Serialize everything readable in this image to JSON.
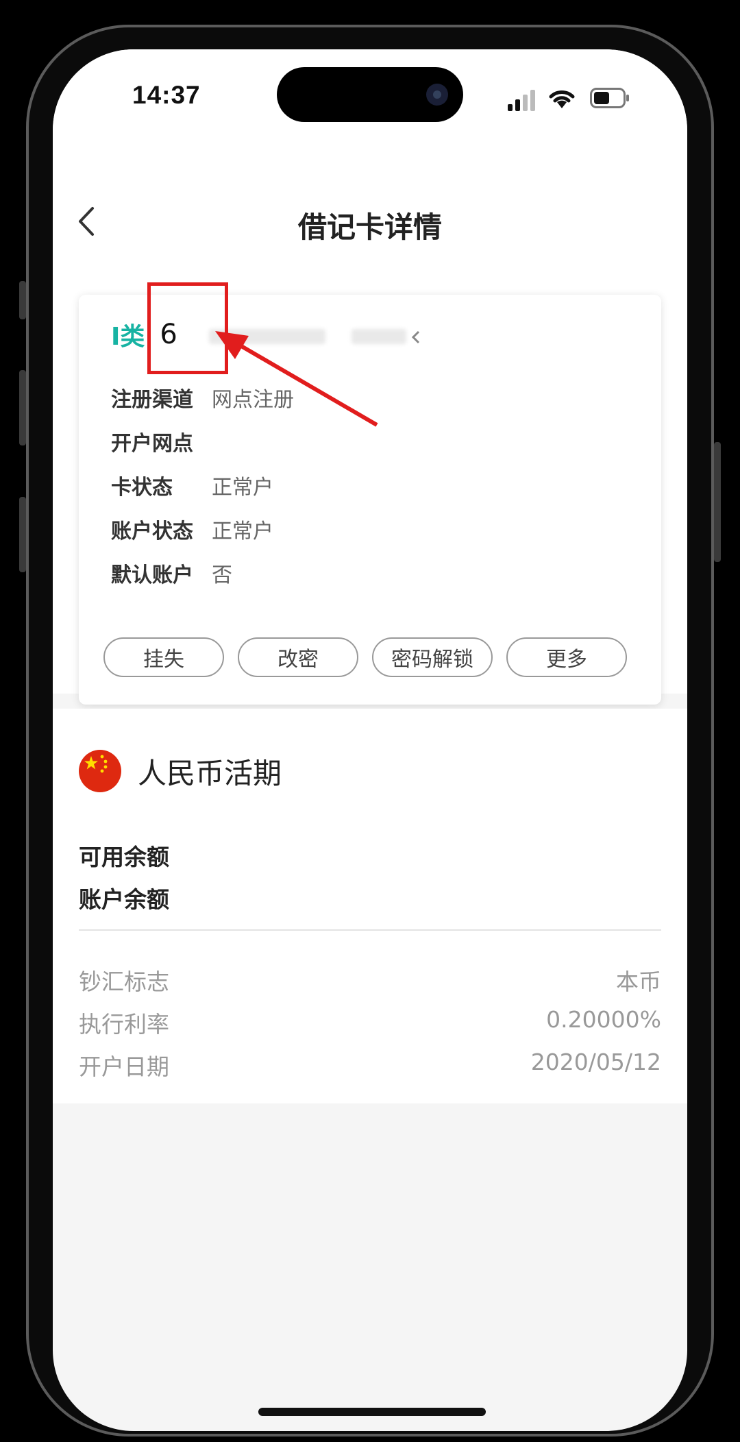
{
  "status_bar": {
    "time": "14:37"
  },
  "header": {
    "title": "借记卡详情"
  },
  "card": {
    "type_label": "I类",
    "number_prefix": "6",
    "details": [
      {
        "label": "注册渠道",
        "value": "网点注册"
      },
      {
        "label": "开户网点",
        "value": ""
      },
      {
        "label": "卡状态",
        "value": "正常户"
      },
      {
        "label": "账户状态",
        "value": "正常户"
      },
      {
        "label": "默认账户",
        "value": "否"
      }
    ],
    "actions": [
      {
        "label": "挂失"
      },
      {
        "label": "改密"
      },
      {
        "label": "密码解锁"
      },
      {
        "label": "更多"
      }
    ]
  },
  "account": {
    "currency_name": "人民币活期",
    "available_balance_label": "可用余额",
    "account_balance_label": "账户余额",
    "info": [
      {
        "label": "钞汇标志",
        "value": "本币"
      },
      {
        "label": "执行利率",
        "value": "0.20000%"
      },
      {
        "label": "开户日期",
        "value": "2020/05/12"
      }
    ]
  },
  "colors": {
    "accent": "#17b3a3",
    "annotation": "#e11d1d",
    "flag": "#de2910"
  }
}
